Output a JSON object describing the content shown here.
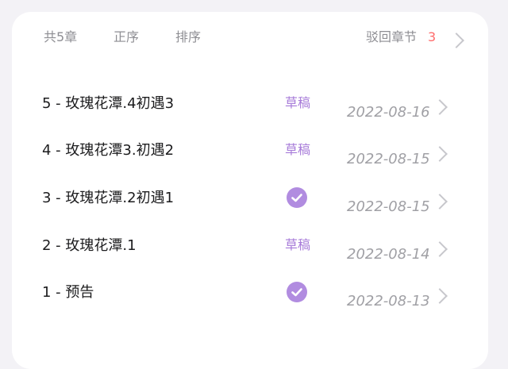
{
  "header": {
    "chapter_count": "共5章",
    "order_asc": "正序",
    "sort": "排序",
    "rejected_label": "驳回章节",
    "rejected_count": "3"
  },
  "chapters": [
    {
      "title": "5 - 玫瑰花潭.4初遇3",
      "status": "draft",
      "status_label": "草稿",
      "date": "2022-08-16"
    },
    {
      "title": "4 - 玫瑰花潭3.初遇2",
      "status": "draft",
      "status_label": "草稿",
      "date": "2022-08-15"
    },
    {
      "title": "3 - 玫瑰花潭.2初遇1",
      "status": "published",
      "status_label": "",
      "date": "2022-08-15"
    },
    {
      "title": "2 - 玫瑰花潭.1",
      "status": "draft",
      "status_label": "草稿",
      "date": "2022-08-14"
    },
    {
      "title": "1 - 预告",
      "status": "published",
      "status_label": "",
      "date": "2022-08-13"
    }
  ],
  "colors": {
    "accent": "#b18ce0",
    "draft_text": "#a77bd9",
    "rejected_count": "#ff6b6b"
  },
  "icons": {
    "published": "check-circle-icon",
    "row_arrow": "chevron-right-icon"
  }
}
